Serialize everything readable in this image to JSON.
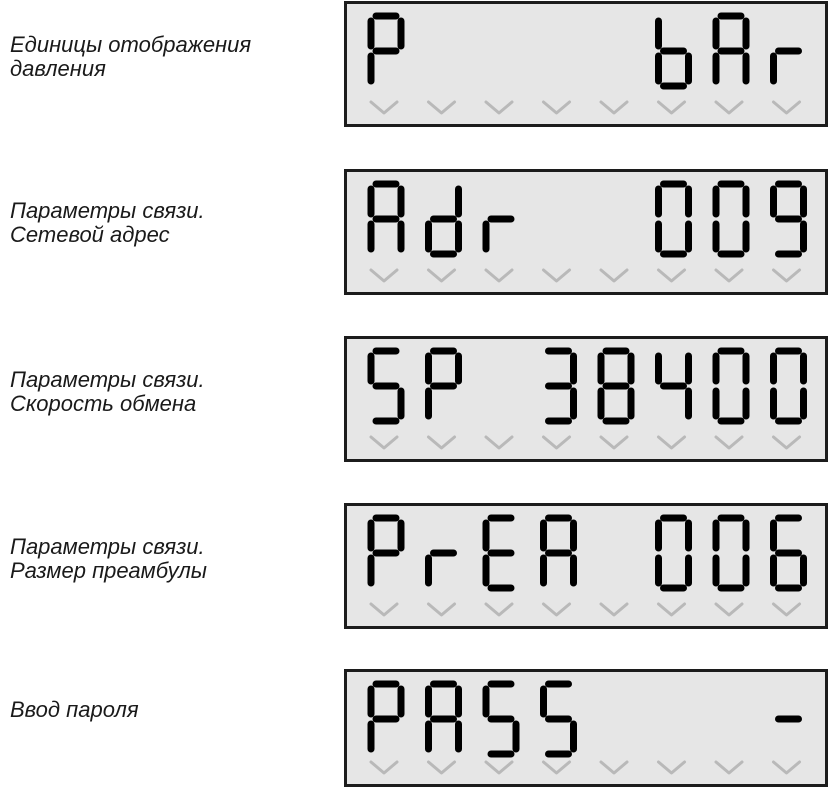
{
  "display_color": "#000000",
  "panel_color": "#e6e6e6",
  "indicator_color": "#b9b9b9",
  "screens": [
    {
      "label_lines": [
        "Единицы отображения",
        "давления"
      ],
      "chars": [
        "P",
        " ",
        " ",
        " ",
        " ",
        "b",
        "A",
        "r"
      ]
    },
    {
      "label_lines": [
        "Параметры связи.",
        "Сетевой адрес"
      ],
      "chars": [
        "A",
        "d",
        "r",
        " ",
        " ",
        "0",
        "0",
        "9"
      ]
    },
    {
      "label_lines": [
        "Параметры связи.",
        "Скорость обмена"
      ],
      "chars": [
        "S",
        "P",
        " ",
        "3",
        "8",
        "4",
        "0",
        "0"
      ]
    },
    {
      "label_lines": [
        "Параметры связи.",
        "Размер преамбулы"
      ],
      "chars": [
        "P",
        "r",
        "E",
        "A",
        " ",
        "0",
        "0",
        "6"
      ]
    },
    {
      "label_lines": [
        "Ввод пароля"
      ],
      "chars": [
        "P",
        "A",
        "S",
        "S",
        " ",
        " ",
        " ",
        "-"
      ]
    }
  ]
}
